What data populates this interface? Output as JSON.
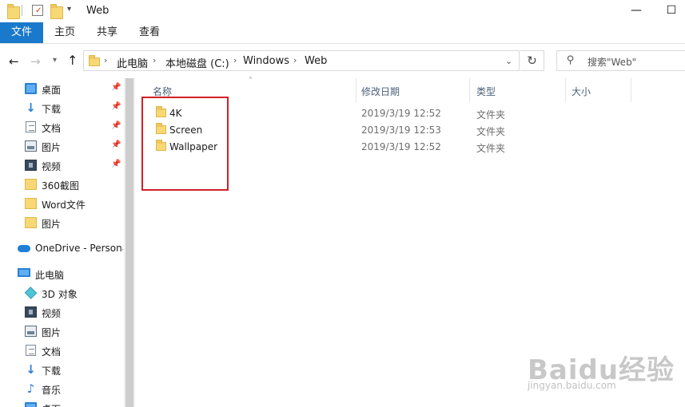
{
  "window": {
    "title": "Web",
    "minimize_glyph": "—",
    "maximize_glyph": "☐"
  },
  "ribbon": {
    "tabs": [
      {
        "label": "文件"
      },
      {
        "label": "主页"
      },
      {
        "label": "共享"
      },
      {
        "label": "查看"
      }
    ]
  },
  "address": {
    "path": [
      "此电脑",
      "本地磁盘 (C:)",
      "Windows",
      "Web"
    ],
    "search_placeholder": "搜索\"Web\""
  },
  "sidebar": {
    "quick_access": [
      {
        "label": "桌面",
        "icon": "desktop-icon",
        "pinned": true
      },
      {
        "label": "下载",
        "icon": "download-icon",
        "pinned": true
      },
      {
        "label": "文档",
        "icon": "document-icon",
        "pinned": true
      },
      {
        "label": "图片",
        "icon": "pictures-icon",
        "pinned": true
      },
      {
        "label": "视频",
        "icon": "videos-icon",
        "pinned": true
      },
      {
        "label": "360截图",
        "icon": "folder-icon",
        "pinned": false
      },
      {
        "label": "Word文件",
        "icon": "folder-icon",
        "pinned": false
      },
      {
        "label": "图片",
        "icon": "folder-icon",
        "pinned": false
      }
    ],
    "onedrive": {
      "label": "OneDrive - Personal",
      "icon": "onedrive-icon"
    },
    "this_pc": {
      "label": "此电脑",
      "icon": "computer-icon"
    },
    "pc_items": [
      {
        "label": "3D 对象",
        "icon": "3d-objects-icon"
      },
      {
        "label": "视频",
        "icon": "videos-icon"
      },
      {
        "label": "图片",
        "icon": "pictures-icon"
      },
      {
        "label": "文档",
        "icon": "document-icon"
      },
      {
        "label": "下载",
        "icon": "download-icon"
      },
      {
        "label": "音乐",
        "icon": "music-icon"
      },
      {
        "label": "桌面",
        "icon": "desktop-icon"
      }
    ]
  },
  "columns": {
    "name": "名称",
    "modified": "修改日期",
    "type": "类型",
    "size": "大小"
  },
  "files": [
    {
      "name": "4K",
      "modified": "2019/3/19 12:52",
      "type": "文件夹"
    },
    {
      "name": "Screen",
      "modified": "2019/3/19 12:53",
      "type": "文件夹"
    },
    {
      "name": "Wallpaper",
      "modified": "2019/3/19 12:52",
      "type": "文件夹"
    }
  ],
  "colors": {
    "file_tab": "#1979ca",
    "highlight_box": "#d32029",
    "folder": "#f8d775"
  },
  "watermark": {
    "logo": "Baidu经验",
    "url": "jingyan.baidu.com"
  }
}
